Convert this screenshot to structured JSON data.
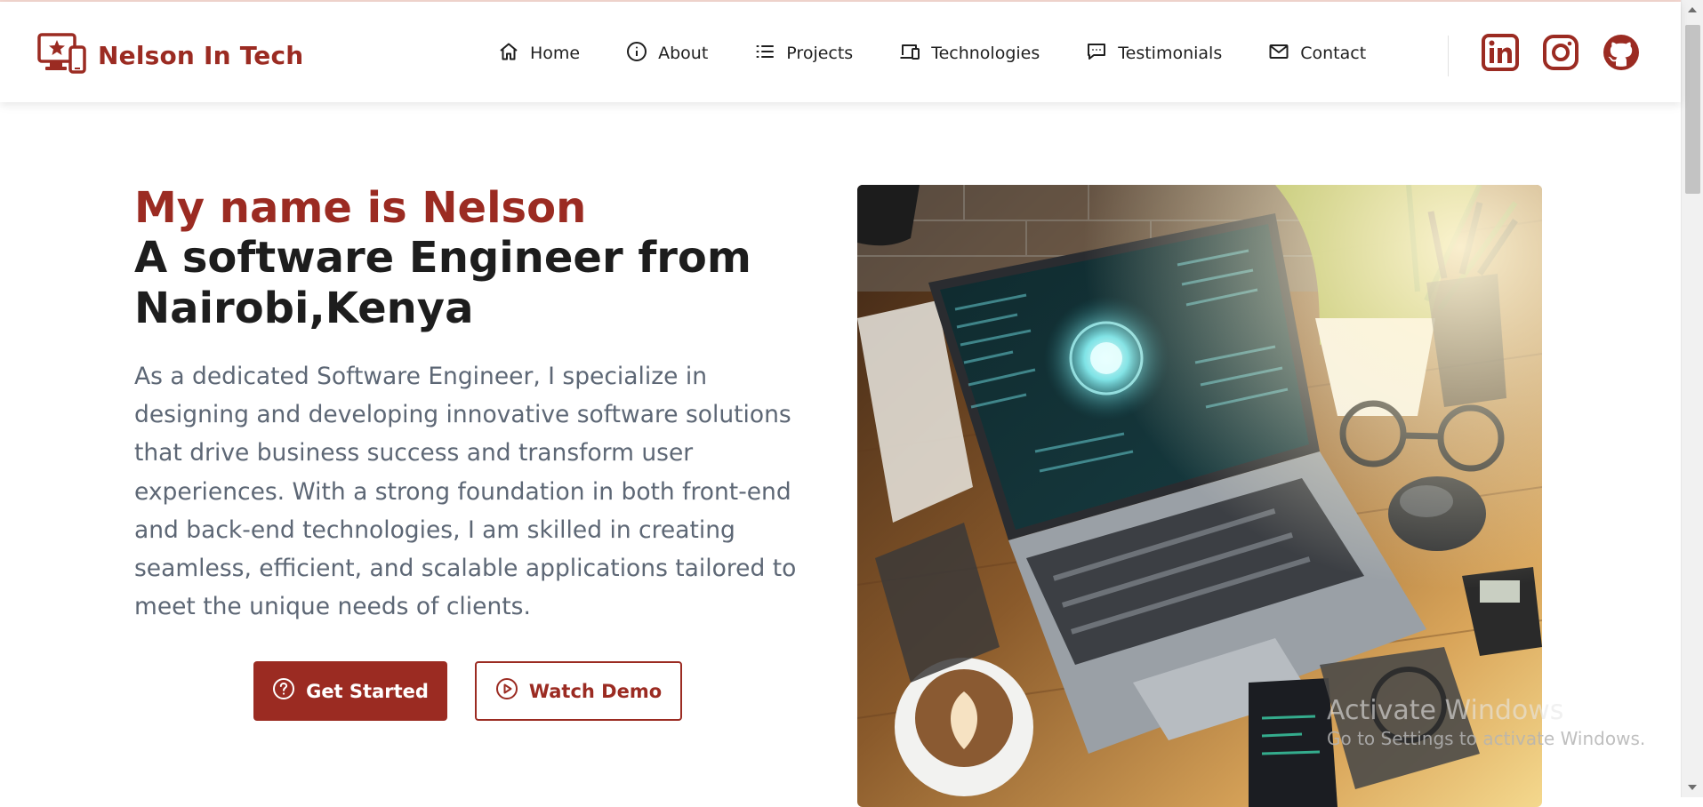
{
  "brand": {
    "name": "Nelson In Tech",
    "icon": "devices-star-icon"
  },
  "nav": {
    "items": [
      {
        "label": "Home",
        "icon": "home-icon"
      },
      {
        "label": "About",
        "icon": "info-icon"
      },
      {
        "label": "Projects",
        "icon": "list-icon"
      },
      {
        "label": "Technologies",
        "icon": "devices-icon"
      },
      {
        "label": "Testimonials",
        "icon": "chat-icon"
      },
      {
        "label": "Contact",
        "icon": "mail-icon"
      }
    ]
  },
  "social": [
    {
      "name": "linkedin-icon"
    },
    {
      "name": "instagram-icon"
    },
    {
      "name": "github-icon"
    }
  ],
  "hero": {
    "name_line": "My name is Nelson",
    "role_line": "A software Engineer from Nairobi,Kenya",
    "description": "As a dedicated Software Engineer, I specialize in designing and developing innovative software solutions that drive business success and transform user experiences. With a strong foundation in both front-end and back-end technologies, I am skilled in creating seamless, efficient, and scalable applications tailored to meet the unique needs of clients.",
    "primary_button": "Get Started",
    "secondary_button": "Watch Demo"
  },
  "watermark": {
    "title": "Activate Windows",
    "subtitle": "Go to Settings to activate Windows."
  },
  "colors": {
    "brand": "#9b2b22",
    "heading": "#1d1d1d",
    "body_text": "#5d6775"
  }
}
